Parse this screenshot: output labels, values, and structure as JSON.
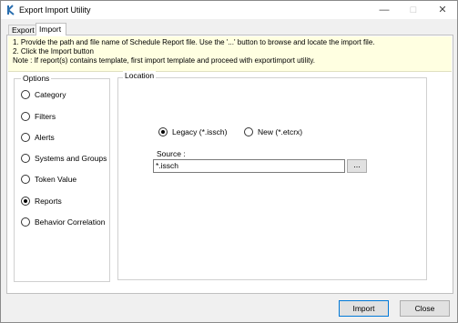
{
  "window": {
    "title": "Export Import Utility"
  },
  "tabs": [
    {
      "label": "Export"
    },
    {
      "label": "Import",
      "selected": true
    }
  ],
  "instructions": [
    "1. Provide the path and file name of Schedule Report file. Use the '...' button to browse and locate the import file.",
    "2. Click the Import button",
    "Note : If report(s) contains template, first import template and proceed with exportimport utility."
  ],
  "options": {
    "label": "Options",
    "selected": "Reports",
    "items": [
      {
        "label": "Category"
      },
      {
        "label": "Filters"
      },
      {
        "label": "Alerts"
      },
      {
        "label": "Systems and Groups"
      },
      {
        "label": "Token Value"
      },
      {
        "label": "Reports"
      },
      {
        "label": "Behavior Correlation"
      }
    ]
  },
  "location": {
    "label": "Location",
    "format_selected": "Legacy (*.issch)",
    "formats": [
      {
        "label": "Legacy (*.issch)"
      },
      {
        "label": "New (*.etcrx)"
      }
    ],
    "source_label": "Source :",
    "source_value": "*.issch",
    "browse_label": "..."
  },
  "buttons": {
    "import_label": "Import",
    "close_label": "Close"
  }
}
